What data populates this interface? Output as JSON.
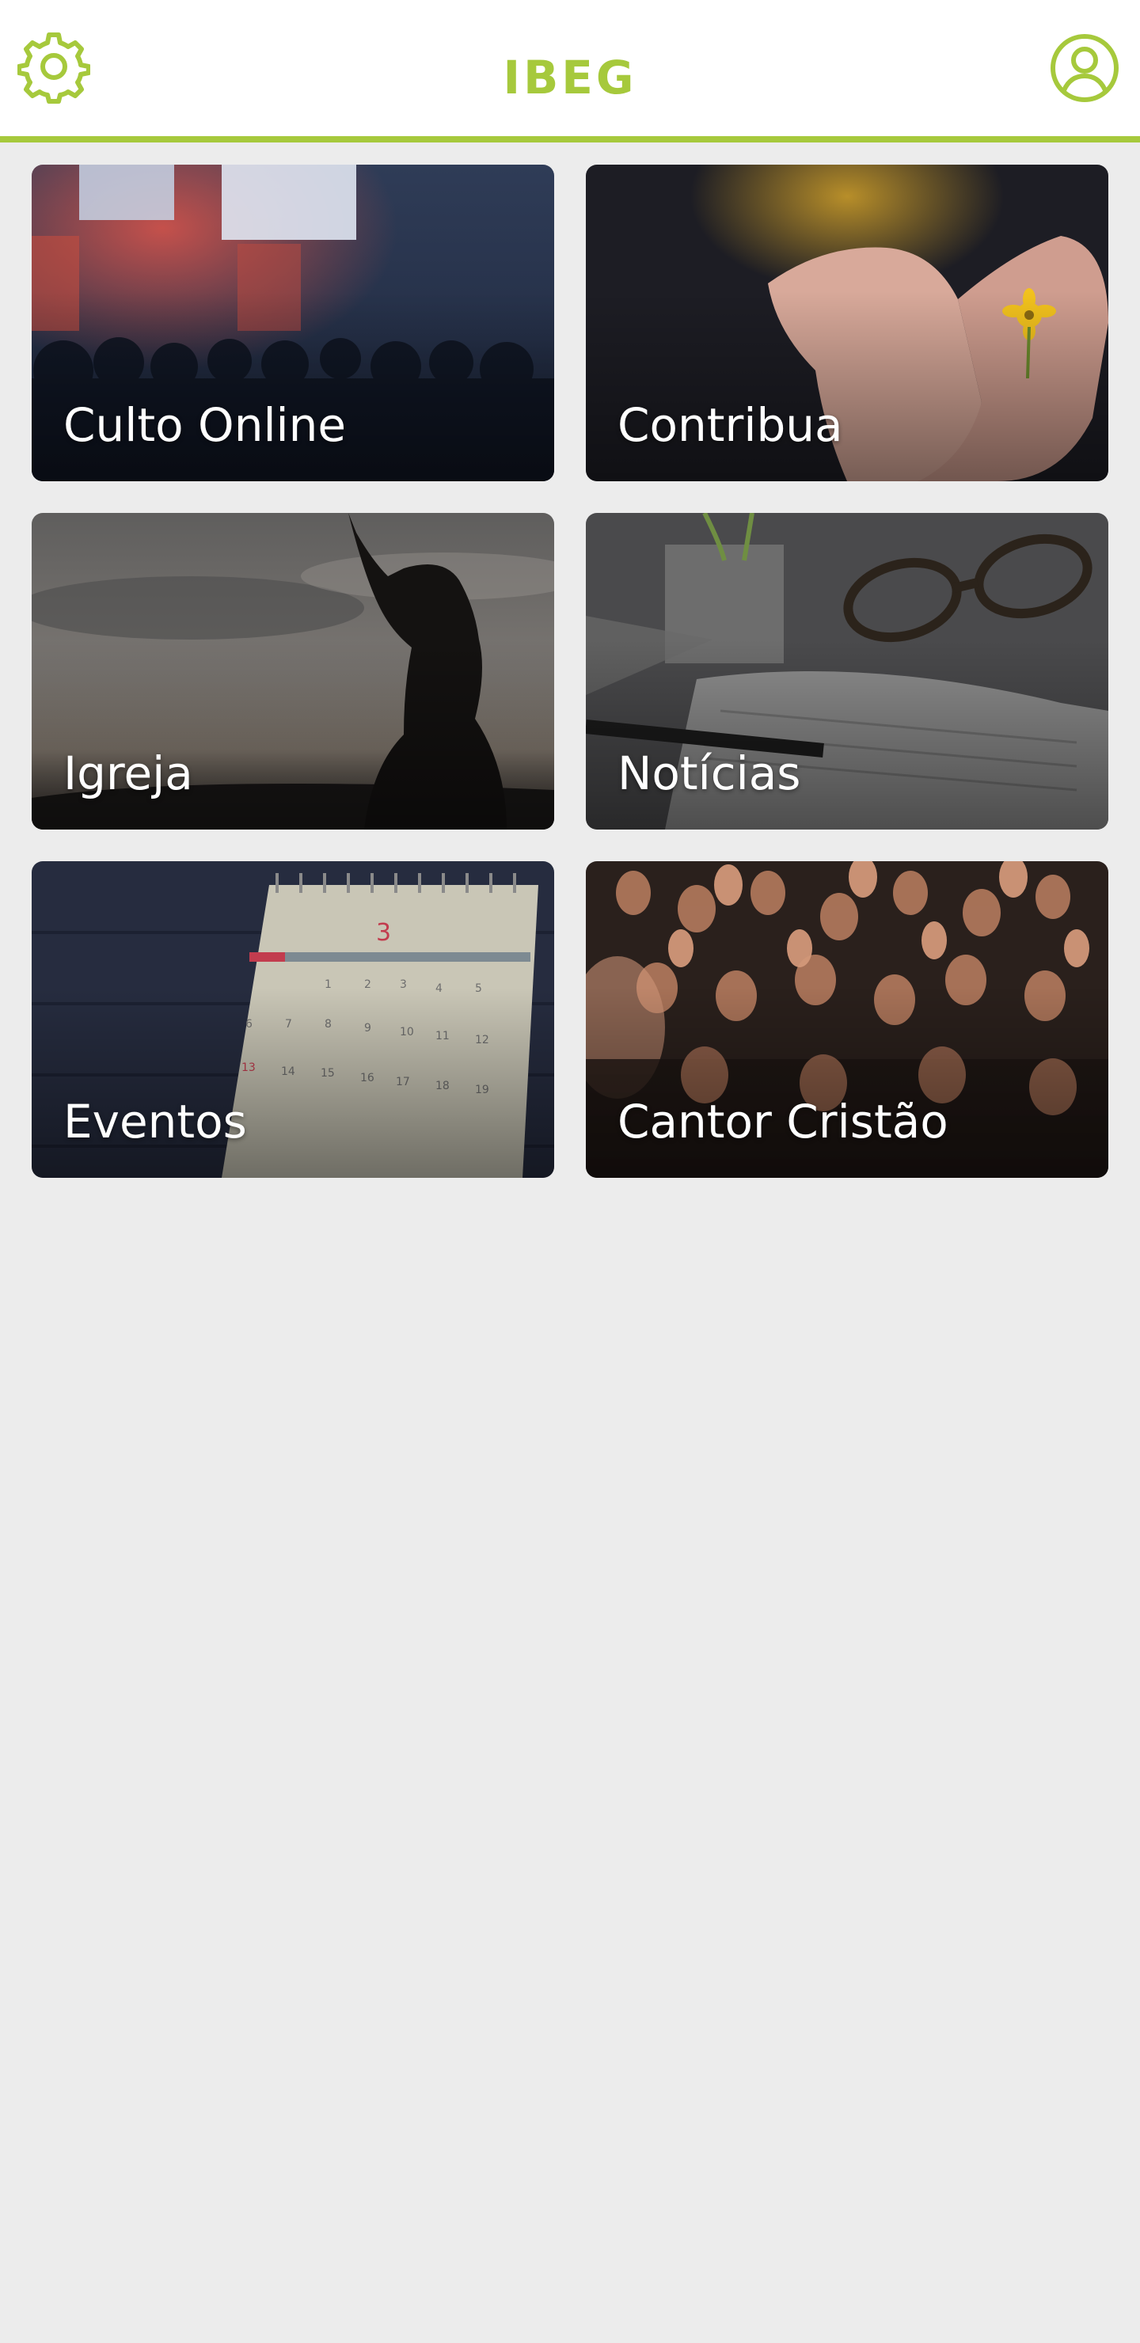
{
  "header": {
    "title": "IBEG",
    "settings_icon": "gear-icon",
    "profile_icon": "user-circle-icon"
  },
  "theme": {
    "accent": "#a6c93c",
    "background": "#ececec"
  },
  "tiles": [
    {
      "label": "Culto Online",
      "image": "concert-crowd-photo"
    },
    {
      "label": "Contribua",
      "image": "hands-holding-flower-photo"
    },
    {
      "label": "Igreja",
      "image": "praying-silhouette-photo"
    },
    {
      "label": "Notícias",
      "image": "glasses-on-newspaper-photo"
    },
    {
      "label": "Eventos",
      "image": "desk-calendar-photo"
    },
    {
      "label": "Cantor Cristão",
      "image": "worship-crowd-hands-photo"
    }
  ]
}
